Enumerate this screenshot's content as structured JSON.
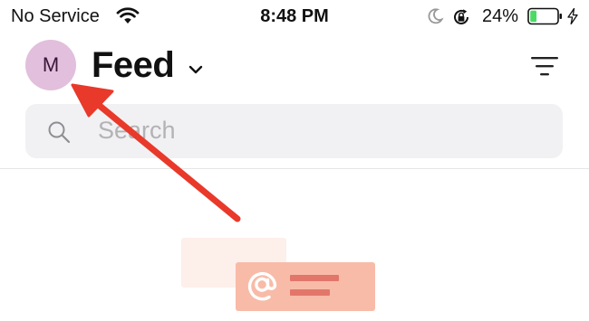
{
  "status_bar": {
    "carrier": "No Service",
    "time": "8:48 PM",
    "battery_percent": "24%",
    "battery_level": 0.24,
    "icons": [
      "wifi-icon",
      "moon-icon",
      "rotation-lock-icon",
      "battery-icon",
      "charging-bolt-icon"
    ]
  },
  "header": {
    "avatar_initial": "M",
    "title": "Feed",
    "title_dropdown_icon": "chevron-down-icon",
    "filter_icon": "filter-icon"
  },
  "search": {
    "placeholder": "Search",
    "icon": "search-icon"
  },
  "empty_state": {
    "illustration_icon": "at-mention-icon"
  },
  "annotation": {
    "type": "arrow",
    "color": "#e8392b",
    "points_to": "avatar"
  },
  "colors": {
    "avatar_bg": "#e2bfdc",
    "avatar_text": "#3a1538",
    "search_bg": "#f1f1f3",
    "battery_fill": "#4cd964",
    "illustration_light": "#fdefea",
    "illustration_mid": "#f8bba8",
    "illustration_dark": "#e2766a",
    "arrow": "#e8392b"
  }
}
